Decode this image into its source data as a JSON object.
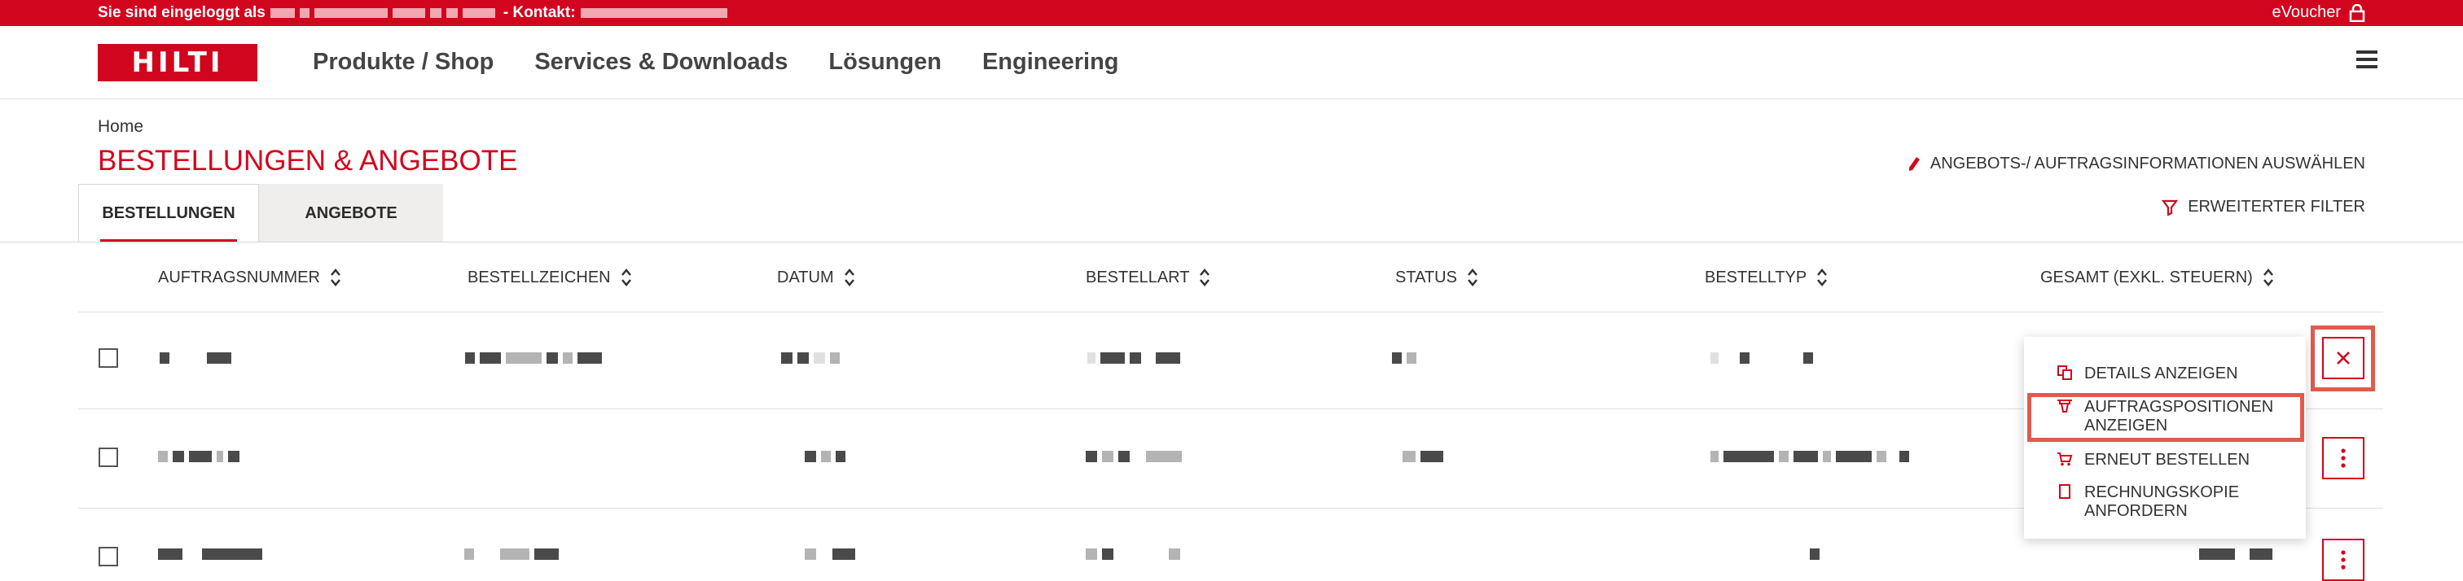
{
  "topbar": {
    "login_text": "Sie sind eingeloggt als",
    "contact_label": "- Kontakt:",
    "voucher_label": "eVoucher"
  },
  "header": {
    "logo_text": "HILTI",
    "nav": [
      "Produkte / Shop",
      "Services & Downloads",
      "Lösungen",
      "Engineering"
    ]
  },
  "page": {
    "breadcrumb": "Home",
    "title": "BESTELLUNGEN & ANGEBOTE",
    "action_select_info": "ANGEBOTS-/ AUFTRAGSINFORMATIONEN AUSWÄHLEN",
    "action_filter": "ERWEITERTER FILTER",
    "tabs": [
      "BESTELLUNGEN",
      "ANGEBOTE"
    ]
  },
  "table": {
    "headers": [
      "AUFTRAGSNUMMER",
      "BESTELLZEICHEN",
      "DATUM",
      "BESTELLART",
      "STATUS",
      "BESTELLTYP",
      "GESAMT (EXKL. STEUERN)"
    ]
  },
  "context_menu": {
    "items": [
      {
        "label": "DETAILS ANZEIGEN",
        "icon": "copy-icon"
      },
      {
        "label": "AUFTRAGSPOSITIONEN ANZEIGEN",
        "icon": "table-icon"
      },
      {
        "label": "ERNEUT BESTELLEN",
        "icon": "cart-icon"
      },
      {
        "label": "RECHNUNGSKOPIE ANFORDERN",
        "icon": "document-icon"
      }
    ]
  },
  "colors": {
    "brand": "#d2051e",
    "highlight": "#e05b4b"
  }
}
